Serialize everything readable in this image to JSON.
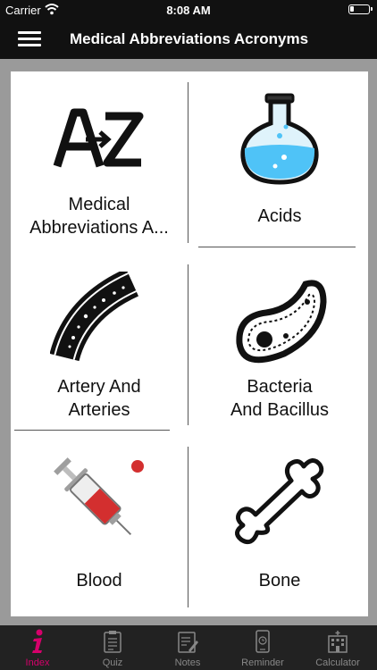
{
  "status_bar": {
    "carrier": "Carrier",
    "time": "8:08 AM"
  },
  "nav": {
    "title": "Medical Abbreviations Acronyms"
  },
  "grid": {
    "items": [
      {
        "label": "Medical Abbreviations Acronyms",
        "label_line1": "Medical",
        "label_line2": "Abbreviations A...",
        "icon": "a-to-z-icon"
      },
      {
        "label": "Acids",
        "icon": "flask-icon"
      },
      {
        "label": "Artery And Arteries",
        "label_line1": "Artery And",
        "label_line2": "Arteries",
        "icon": "artery-icon"
      },
      {
        "label": "Bacteria And Bacillus",
        "label_line1": "Bacteria",
        "label_line2": "And Bacillus",
        "icon": "bacteria-icon"
      },
      {
        "label": "Blood",
        "icon": "syringe-icon"
      },
      {
        "label": "Bone",
        "icon": "bone-icon"
      }
    ]
  },
  "tabs": [
    {
      "label": "Index",
      "icon": "info-icon",
      "active": true
    },
    {
      "label": "Quiz",
      "icon": "clipboard-icon",
      "active": false
    },
    {
      "label": "Notes",
      "icon": "notes-icon",
      "active": false
    },
    {
      "label": "Reminder",
      "icon": "phone-clock-icon",
      "active": false
    },
    {
      "label": "Calculator",
      "icon": "building-icon",
      "active": false
    }
  ],
  "colors": {
    "active_tab": "#d6006b",
    "inactive_tab": "#888888",
    "bar_bg": "#111111",
    "content_bg": "#9a9a9a",
    "flask_liquid": "#4fc3f7",
    "blood_red": "#d32f2f"
  }
}
